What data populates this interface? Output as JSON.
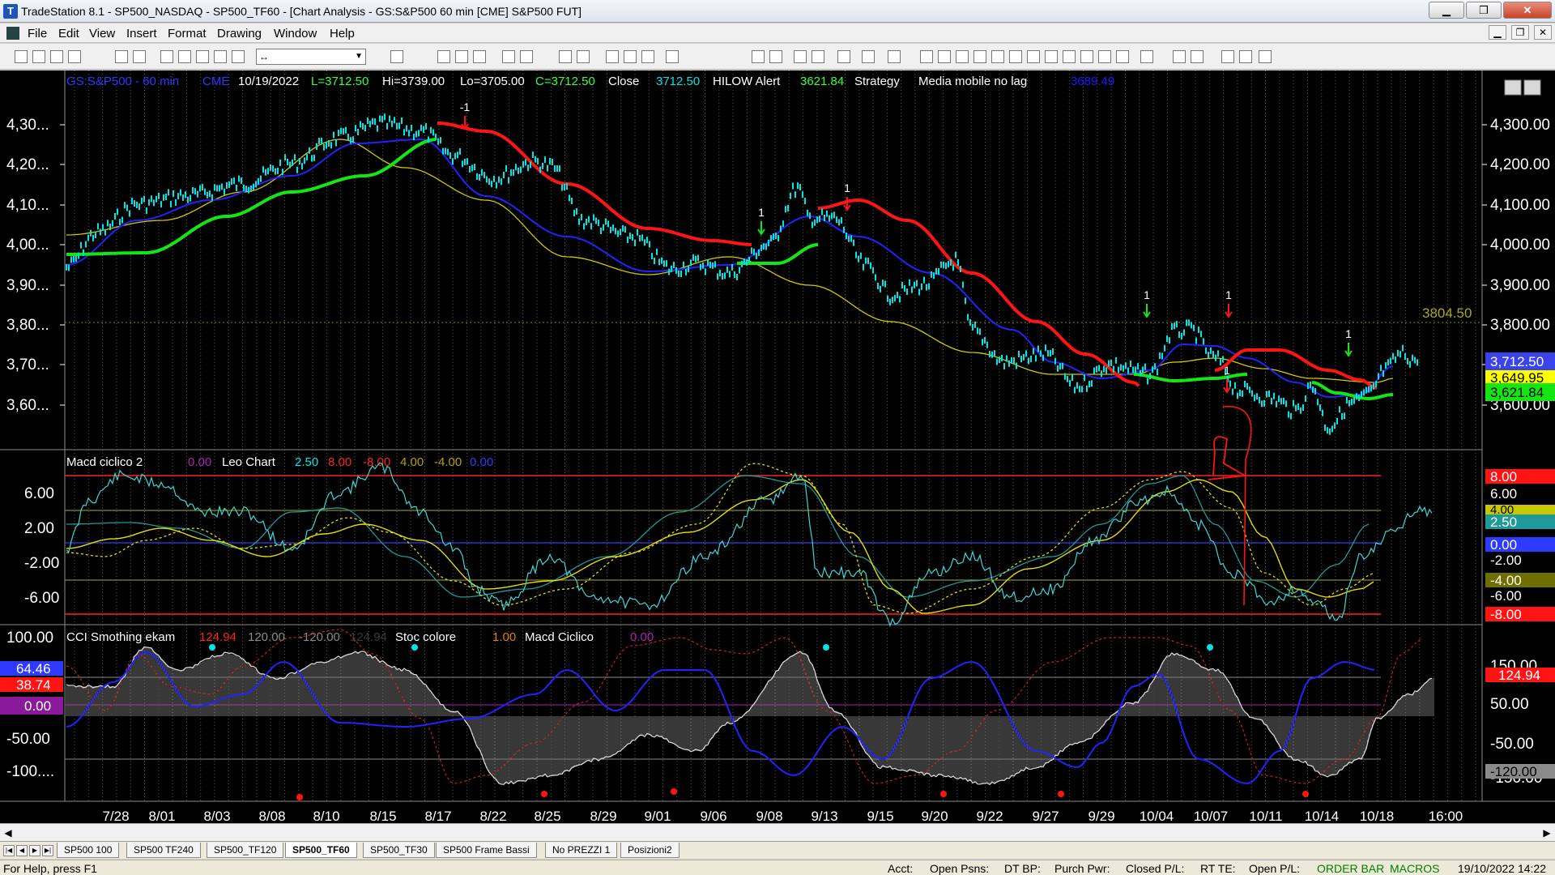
{
  "window": {
    "title": "TradeStation 8.1 - SP500_NASDAQ - SP500_TF60 - [Chart Analysis - GS:S&P500  60 min  [CME] S&P500 FUT]",
    "minimize": "▁",
    "maximize": "❒",
    "close": "✕"
  },
  "menu": {
    "items": [
      "File",
      "Edit",
      "View",
      "Insert",
      "Format",
      "Drawing",
      "Window",
      "Help"
    ],
    "mdi": [
      "▁",
      "❐",
      "✕"
    ]
  },
  "toolbar": {
    "combo_value": "↔"
  },
  "colors": {
    "background": "#000000",
    "price_bar": "#00e6e6",
    "ma_blue": "#2222ff",
    "ma_yellow": "#d4c800",
    "hilow_red": "#ff1414",
    "hilow_green": "#14e614",
    "grid": "#8a8a8a"
  },
  "price_panel": {
    "info": {
      "symbol": "GS:S&P500 - 60 min",
      "exchange": "CME",
      "date": "10/19/2022",
      "low_label": "L=3712.50",
      "high_label": "Hi=3739.00",
      "lo_label": "Lo=3705.00",
      "close_label": "C=3712.50",
      "close_word": "Close",
      "close_value": "3712.50",
      "hilow_name": "HILOW Alert",
      "hilow_value": "3621.84",
      "strategy": "Strategy",
      "media_name": "Media mobile no lag",
      "media_value": "3689.49"
    },
    "y_ticks_left": [
      "4,30...",
      "4,20...",
      "4,10...",
      "4,00...",
      "3,90...",
      "3,80...",
      "3,70...",
      "3,60..."
    ],
    "y_ticks_right": [
      "4,300.00",
      "4,200.00",
      "4,100.00",
      "4,000.00",
      "3,900.00",
      "3,800.00",
      "3,700.00",
      "3,600.00"
    ],
    "level_line": "3804.50",
    "badges": [
      "3,712.50",
      "3,649.95",
      "3,621.84"
    ],
    "signals": [
      "-1",
      "1",
      "1",
      "1",
      "1",
      "1",
      "1"
    ]
  },
  "macd_panel": {
    "info": {
      "name": "Macd ciclico 2",
      "v0": "0.00",
      "leo": "Leo Chart",
      "v1": "2.50",
      "v2": "8.00",
      "v3": "-8.00",
      "v4": "4.00",
      "v5": "-4.00",
      "v6": "0.00"
    },
    "y_ticks_left": [
      "6.00",
      "2.00",
      "-2.00",
      "-6.00"
    ],
    "y_ticks_right": [
      "8.00",
      "6.00",
      "4.00",
      "2.50",
      "0.00",
      "-2.00",
      "-4.00",
      "-6.00",
      "-8.00"
    ],
    "annotation": "R"
  },
  "cci_panel": {
    "info": {
      "name": "CCI Smothing ekam",
      "v0": "124.94",
      "v1": "120.00",
      "v2": "-120.00",
      "v3": "124.94",
      "stoc": "Stoc colore",
      "stoc_v": "1.00",
      "macd": "Macd Ciclico",
      "macd_v": "0.00"
    },
    "y_ticks_left": [
      "100.00",
      "-50.00",
      "-100...."
    ],
    "left_badges": [
      "64.46",
      "38.74",
      "0.00"
    ],
    "y_ticks_right": [
      "150.00",
      "50.00",
      "-50.00",
      "-150.00"
    ],
    "right_badges": [
      "124.94",
      "-120.00"
    ]
  },
  "x_axis": [
    "7/28",
    "8/01",
    "8/03",
    "8/08",
    "8/10",
    "8/15",
    "8/17",
    "8/22",
    "8/25",
    "8/29",
    "9/01",
    "9/06",
    "9/08",
    "9/13",
    "9/15",
    "9/20",
    "9/22",
    "9/27",
    "9/29",
    "10/04",
    "10/07",
    "10/11",
    "10/14",
    "10/18",
    "16:00"
  ],
  "tabs": [
    "SP500 100",
    "SP500 TF240",
    "SP500_TF120",
    "SP500_TF60",
    "SP500_TF30",
    "SP500 Frame Bassi",
    "No PREZZI 1",
    "Posizioni2"
  ],
  "active_tab": "SP500_TF60",
  "status": {
    "help": "For Help, press F1",
    "acct": "Acct:",
    "open_psns": "Open Psns:",
    "dt_bp": "DT BP:",
    "purch_pwr": "Purch Pwr:",
    "closed_pl": "Closed P/L:",
    "rt_te": "RT TE:",
    "open_pl": "Open P/L:",
    "order_bar": "ORDER BAR",
    "macros": "MACROS",
    "datetime": "19/10/2022 14:22"
  }
}
